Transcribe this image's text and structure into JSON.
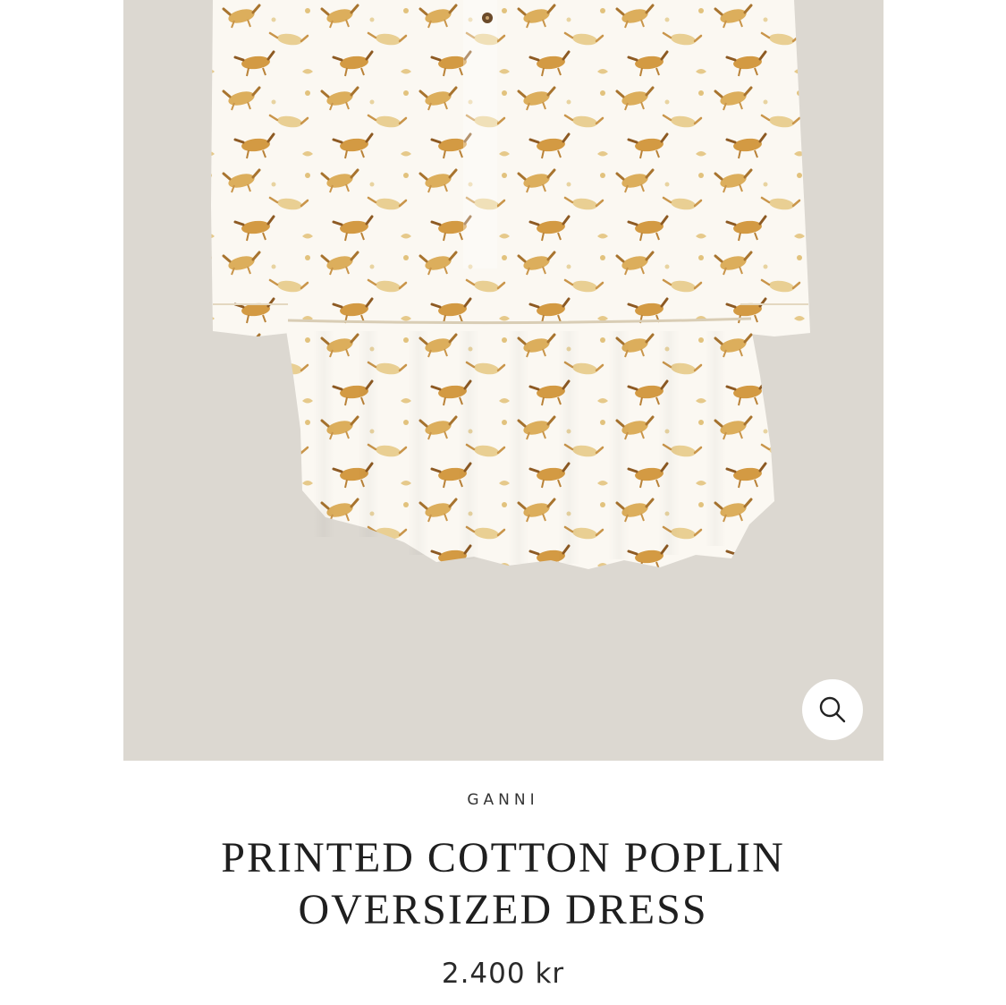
{
  "product": {
    "image_alt": "Printed cotton poplin oversized dress with horse print",
    "zoom_icon": "search-icon",
    "brand": "GANNI",
    "title": "PRINTED COTTON POPLIN OVERSIZED DRESS",
    "price": "2.400 kr"
  },
  "colors": {
    "image_background": "#dcd8d1",
    "dress_fabric": "#fbf8f2",
    "print_ochre": "#d5a24a",
    "print_brown": "#9c6a2e",
    "text": "#1f1f1f"
  }
}
